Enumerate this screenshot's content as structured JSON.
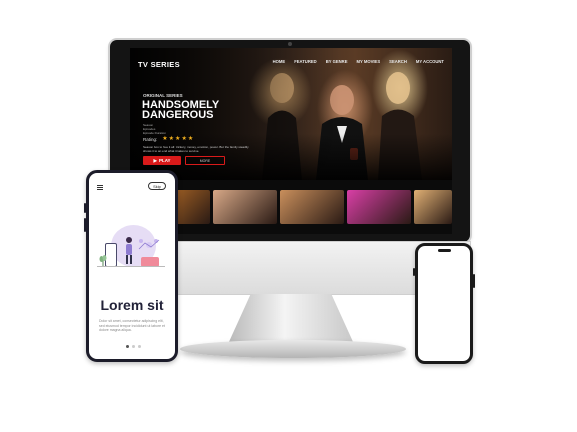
{
  "desktop": {
    "brand": "TV SERIES",
    "nav": [
      "HOME",
      "FEATURED",
      "BY GENRE",
      "MY MOVIES",
      "SEARCH",
      "MY ACCOUNT"
    ],
    "hero": {
      "kicker": "ORIGINAL SERIES",
      "title_line1": "HANDSOMELY",
      "title_line2": "DANGEROUS",
      "meta_lines": [
        "Season",
        "Episodes",
        "Episode Duration"
      ],
      "rating_label": "Rating:",
      "rating": 4.5,
      "rating_max": 5,
      "description": "Season box to hue it all: trickery, money, emotion, power. But the family steadily shows it to an end what it takes to survive.",
      "play_label": "PLAY",
      "more_label": "MORE"
    },
    "thumbnails": [
      {
        "name": "thumb-1",
        "color": "#6a1530"
      },
      {
        "name": "thumb-2",
        "color": "#c7772a"
      },
      {
        "name": "thumb-3",
        "color": "#d7a887"
      },
      {
        "name": "thumb-4",
        "color": "#c98f5c"
      },
      {
        "name": "thumb-5",
        "color": "#d93fa6"
      },
      {
        "name": "thumb-6",
        "color": "#e0b074"
      }
    ]
  },
  "phone_left": {
    "skip_label": "Skip",
    "title": "Lorem sit",
    "body": "Dolor sit amet, consectetur adipiscing elit, sed eiusmod tempor incididunt ut labore et dolore magna aliqua.",
    "pages": 3,
    "active_page": 1
  },
  "colors": {
    "accent_red": "#d91a1a",
    "star_yellow": "#f2b01e",
    "phone_frame": "#1c1c2a"
  }
}
